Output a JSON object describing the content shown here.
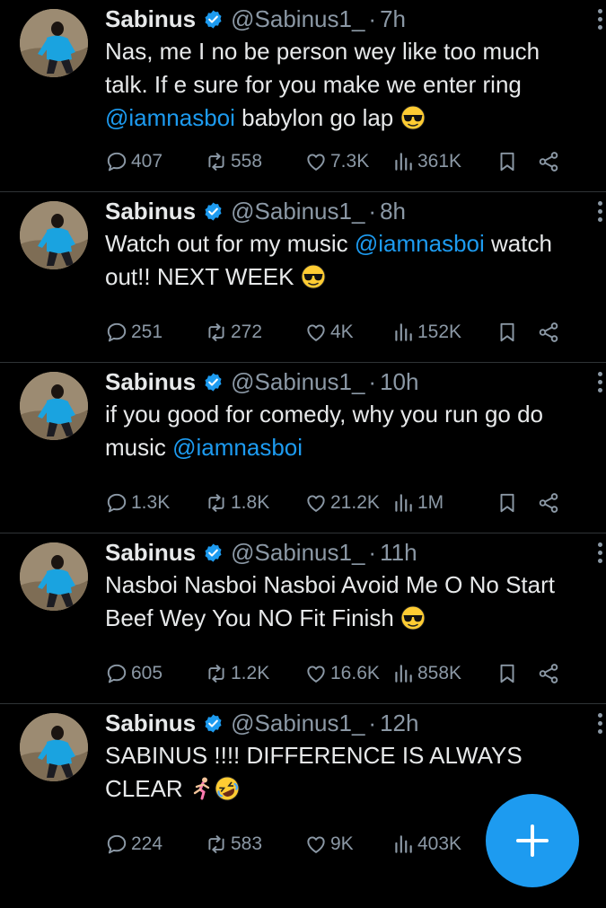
{
  "tweets": [
    {
      "name": "Sabinus",
      "handle": "@Sabinus1_",
      "time": "7h",
      "text_before": "Nas, me I no be person wey like too much talk. If e sure for you make we enter ring ",
      "mention": "@iamnasboi",
      "text_after": " babylon go lap ",
      "emojis": [
        "sunglasses-emoji"
      ],
      "stats": {
        "replies": "407",
        "retweets": "558",
        "likes": "7.3K",
        "views": "361K"
      }
    },
    {
      "name": "Sabinus",
      "handle": "@Sabinus1_",
      "time": "8h",
      "text_before": "Watch out for my music ",
      "mention": "@iamnasboi",
      "text_after": " watch out!! NEXT WEEK ",
      "emojis": [
        "sunglasses-emoji"
      ],
      "stats": {
        "replies": "251",
        "retweets": "272",
        "likes": "4K",
        "views": "152K"
      }
    },
    {
      "name": "Sabinus",
      "handle": "@Sabinus1_",
      "time": "10h",
      "text_before": "if you good for comedy, why you run go do music ",
      "mention": "@iamnasboi",
      "text_after": "",
      "emojis": [],
      "stats": {
        "replies": "1.3K",
        "retweets": "1.8K",
        "likes": "21.2K",
        "views": "1M"
      }
    },
    {
      "name": "Sabinus",
      "handle": "@Sabinus1_",
      "time": "11h",
      "text_before": "Nasboi Nasboi Nasboi Avoid Me O No Start Beef Wey You NO Fit Finish ",
      "mention": "",
      "text_after": "",
      "emojis": [
        "sunglasses-emoji"
      ],
      "stats": {
        "replies": "605",
        "retweets": "1.2K",
        "likes": "16.6K",
        "views": "858K"
      }
    },
    {
      "name": "Sabinus",
      "handle": "@Sabinus1_",
      "time": "12h",
      "text_before": "SABINUS !!!! DIFFERENCE IS ALWAYS CLEAR ",
      "mention": "",
      "text_after": "",
      "emojis": [
        "running-man-emoji",
        "rolling-laughing-emoji"
      ],
      "stats": {
        "replies": "224",
        "retweets": "583",
        "likes": "9K",
        "views": "403K"
      }
    }
  ],
  "colors": {
    "background": "#000000",
    "text": "#e7e9ea",
    "muted": "#8b98a5",
    "accent": "#1d9bf0",
    "divider": "#2f3336"
  },
  "fab": {
    "icon": "plus-icon"
  }
}
